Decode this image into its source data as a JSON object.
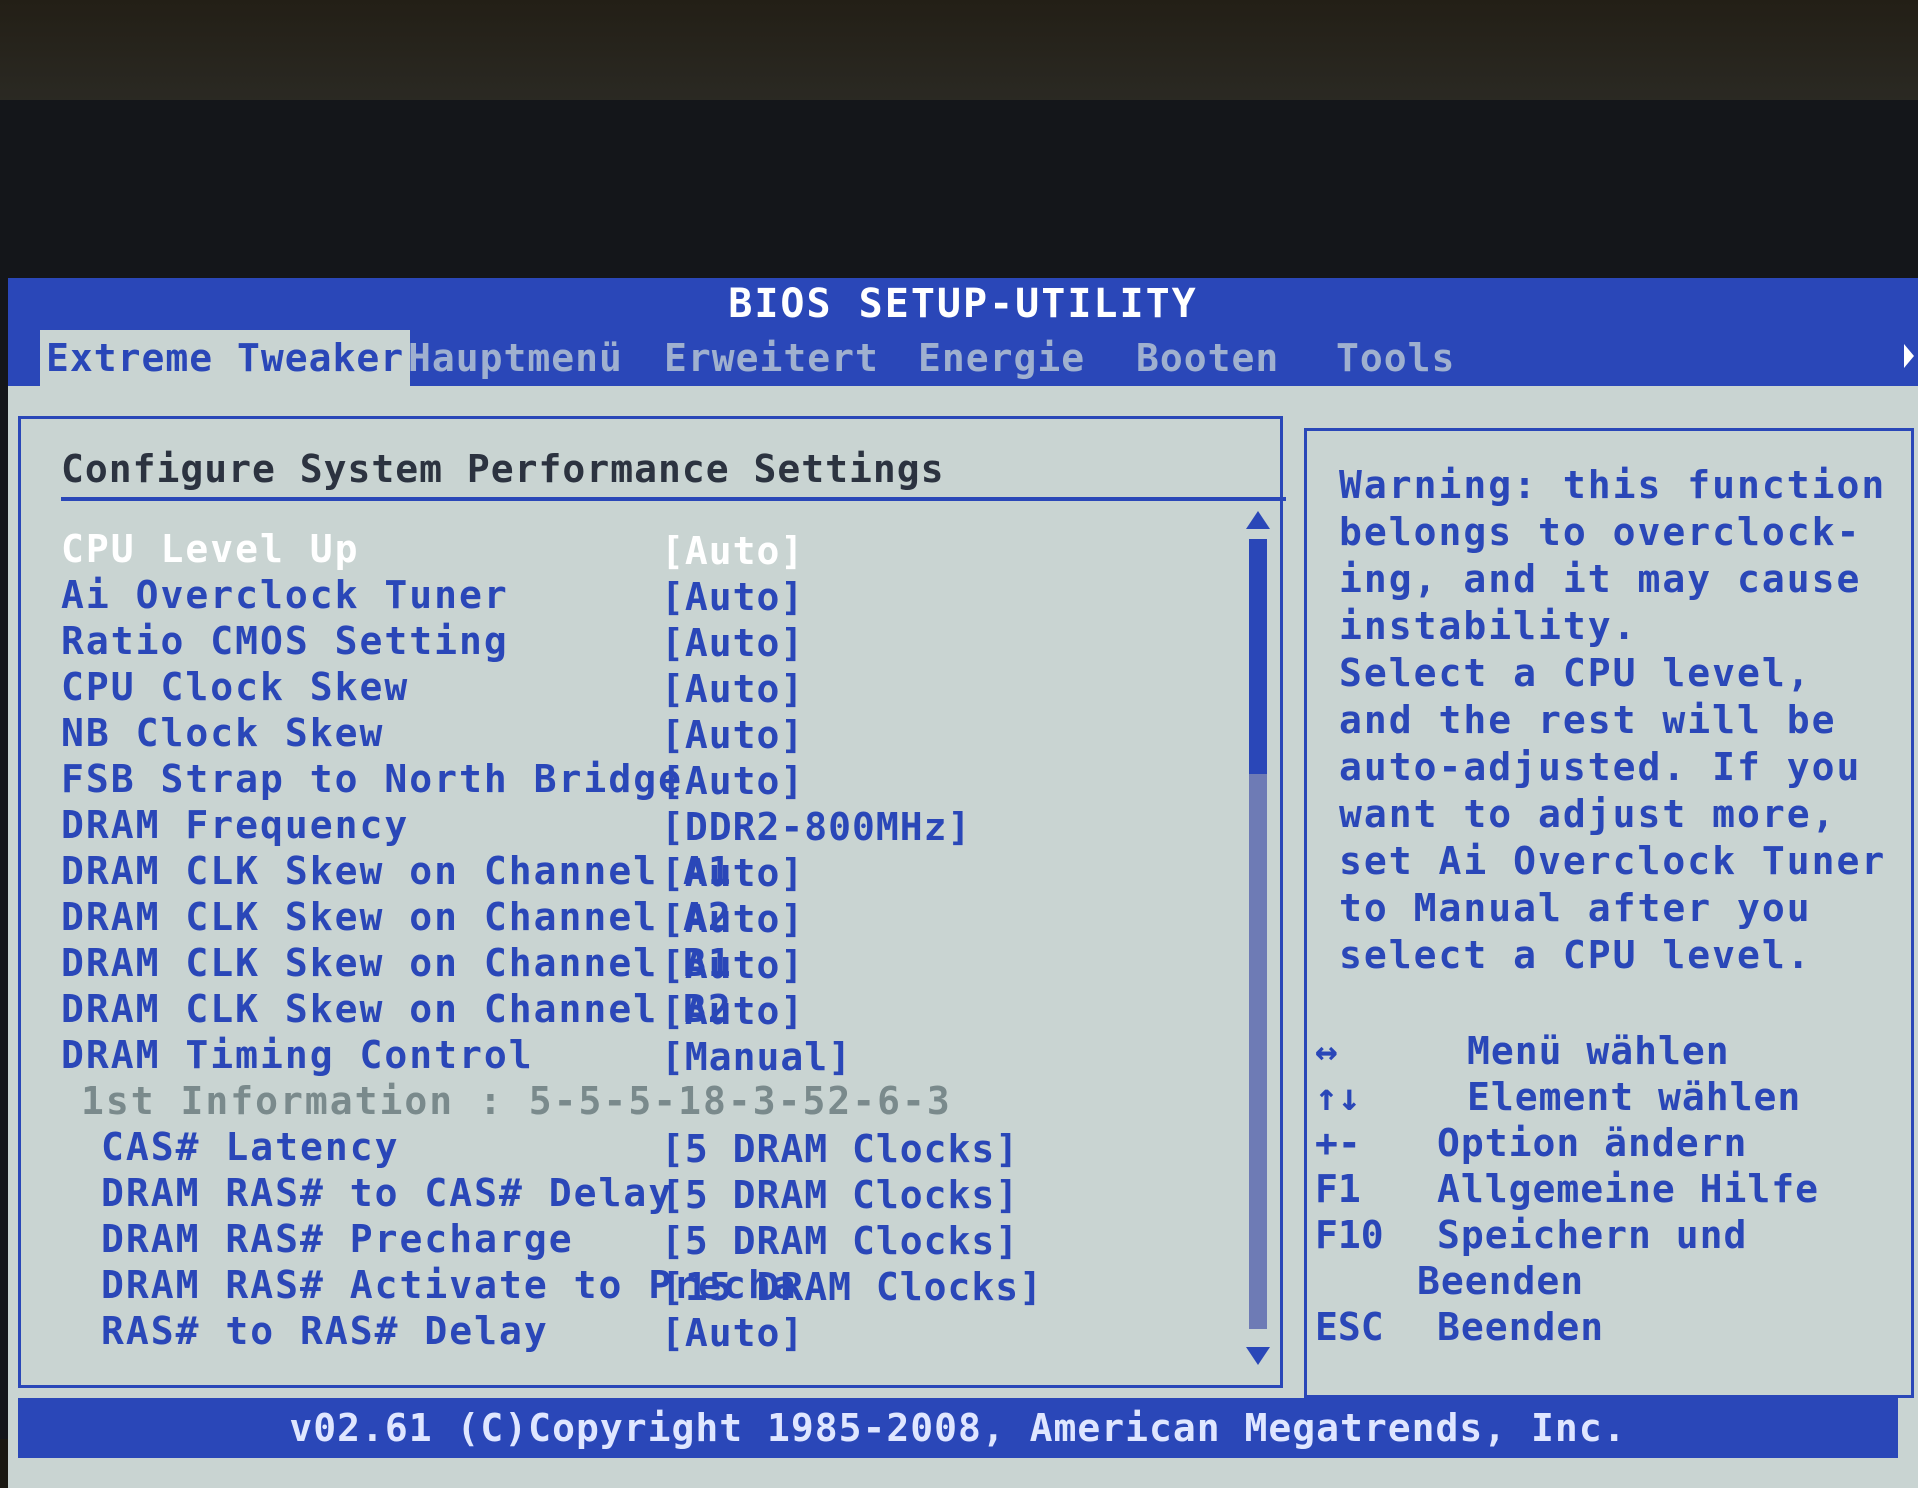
{
  "title": "BIOS SETUP-UTILITY",
  "menu": [
    {
      "label": "Extreme Tweaker",
      "active": true
    },
    {
      "label": "Hauptmenü",
      "active": false
    },
    {
      "label": "Erweitert",
      "active": false
    },
    {
      "label": "Energie",
      "active": false
    },
    {
      "label": "Booten",
      "active": false
    },
    {
      "label": "Tools",
      "active": false
    }
  ],
  "panel_title": "Configure System Performance Settings",
  "settings": [
    {
      "label": "CPU Level Up",
      "value": "[Auto]"
    },
    {
      "label": "Ai Overclock Tuner",
      "value": "[Auto]"
    },
    {
      "label": "Ratio CMOS Setting",
      "value": "[Auto]"
    },
    {
      "label": "CPU Clock Skew",
      "value": "[Auto]"
    },
    {
      "label": "NB Clock Skew",
      "value": "[Auto]"
    },
    {
      "label": "FSB Strap to North Bridge",
      "value": "[Auto]"
    },
    {
      "label": "DRAM Frequency",
      "value": "[DDR2-800MHz]"
    },
    {
      "label": "DRAM CLK Skew on Channel A1",
      "value": "[Auto]"
    },
    {
      "label": "DRAM CLK Skew on Channel A2",
      "value": "[Auto]"
    },
    {
      "label": "DRAM CLK Skew on Channel B1",
      "value": "[Auto]"
    },
    {
      "label": "DRAM CLK Skew on Channel B2",
      "value": "[Auto]"
    },
    {
      "label": "DRAM Timing Control",
      "value": "[Manual]"
    }
  ],
  "info_line": "1st Information : 5-5-5-18-3-52-6-3",
  "sub_settings": [
    {
      "label": "CAS# Latency",
      "value": "[5 DRAM Clocks]"
    },
    {
      "label": "DRAM RAS# to CAS# Delay",
      "value": "[5 DRAM Clocks]"
    },
    {
      "label": "DRAM RAS# Precharge",
      "value": "[5 DRAM Clocks]"
    },
    {
      "label": "DRAM RAS# Activate to Precha",
      "value": "[15 DRAM Clocks]"
    },
    {
      "label": "RAS# to RAS# Delay",
      "value": "[Auto]"
    }
  ],
  "help_text": [
    "Warning: this function",
    "belongs to overclock-",
    "ing, and it may cause",
    "instability.",
    "Select a CPU level,",
    "and the rest will be",
    "auto-adjusted. If you",
    "want to adjust more,",
    "set Ai Overclock Tuner",
    "to Manual after you",
    "select a CPU level."
  ],
  "keys": [
    {
      "key": "↔",
      "desc": "Menü wählen"
    },
    {
      "key": "↑↓",
      "desc": "Element wählen"
    },
    {
      "key": "+-",
      "desc": "Option ändern"
    },
    {
      "key": "F1",
      "desc": "Allgemeine Hilfe"
    },
    {
      "key": "F10",
      "desc": "Speichern und"
    },
    {
      "key": "",
      "desc": "Beenden"
    },
    {
      "key": "ESC",
      "desc": "Beenden"
    }
  ],
  "footer": "v02.61 (C)Copyright 1985-2008, American Megatrends, Inc.",
  "colors": {
    "screen_bg": "#c9d4d2",
    "accent_blue": "#2a47b8",
    "selected_text": "#ffffff",
    "info_gray": "#7a8a8c"
  }
}
